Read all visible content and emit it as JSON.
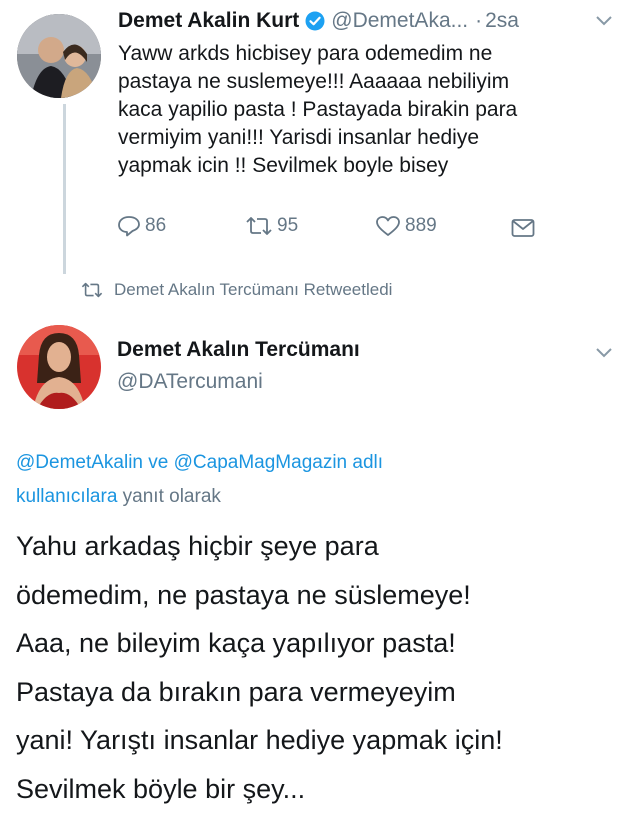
{
  "tweet1": {
    "display_name": "Demet Akalin Kurt",
    "handle": "@DemetAka...",
    "separator": "·",
    "time": "2sa",
    "lines": [
      "Yaww arkds hicbisey para odemedim ne",
      "pastaya ne suslemeye!!! Aaaaaa nebiliyim",
      "kaca yapilio pasta ! Pastayada birakin para",
      "vermiyim yani!!! Yarisdi insanlar hediye",
      "yapmak icin !! Sevilmek boyle bisey"
    ],
    "actions": {
      "replies": "86",
      "retweets": "95",
      "likes": "889"
    }
  },
  "retweet_banner": {
    "text": "Demet Akalın Tercümanı Retweetledi"
  },
  "tweet2": {
    "display_name": "Demet Akalın Tercümanı",
    "handle": "@DATercumani",
    "reply_context": {
      "mention1": "@DemetAkalin",
      "connector": " ve ",
      "mention2": "@CapaMagMagazin adlı",
      "users_link": "kullanıcılara",
      "suffix": " yanıt olarak"
    },
    "lines": [
      "Yahu arkadaş hiçbir şeye para",
      "ödemedim, ne pastaya ne süslemeye!",
      "Aaa, ne bileyim kaça yapılıyor pasta!",
      "Pastaya da bırakın para vermeyeyim",
      "yani! Yarıştı insanlar hediye yapmak için!",
      "Sevilmek böyle bir şey..."
    ]
  },
  "colors": {
    "link_blue": "#1b95e0",
    "verified_blue": "#1da1f2",
    "text_dark": "#14171a",
    "muted_gray": "#657786"
  }
}
